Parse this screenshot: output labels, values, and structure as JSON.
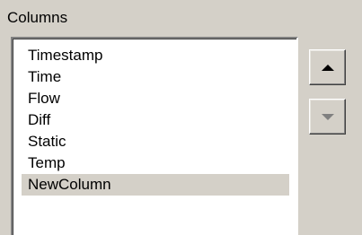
{
  "group": {
    "label": "Columns"
  },
  "columns_list": {
    "items": [
      {
        "label": "Timestamp",
        "selected": false
      },
      {
        "label": "Time",
        "selected": false
      },
      {
        "label": "Flow",
        "selected": false
      },
      {
        "label": "Diff",
        "selected": false
      },
      {
        "label": "Static",
        "selected": false
      },
      {
        "label": "Temp",
        "selected": false
      },
      {
        "label": "NewColumn",
        "selected": true
      }
    ]
  },
  "buttons": {
    "move_up": {
      "icon": "arrow-up-icon",
      "enabled": true
    },
    "move_down": {
      "icon": "arrow-down-icon",
      "enabled": false
    }
  },
  "colors": {
    "background": "#d4d0c8",
    "list_background": "#ffffff",
    "selection": "#d4d0c8",
    "disabled_glyph": "#808080"
  }
}
